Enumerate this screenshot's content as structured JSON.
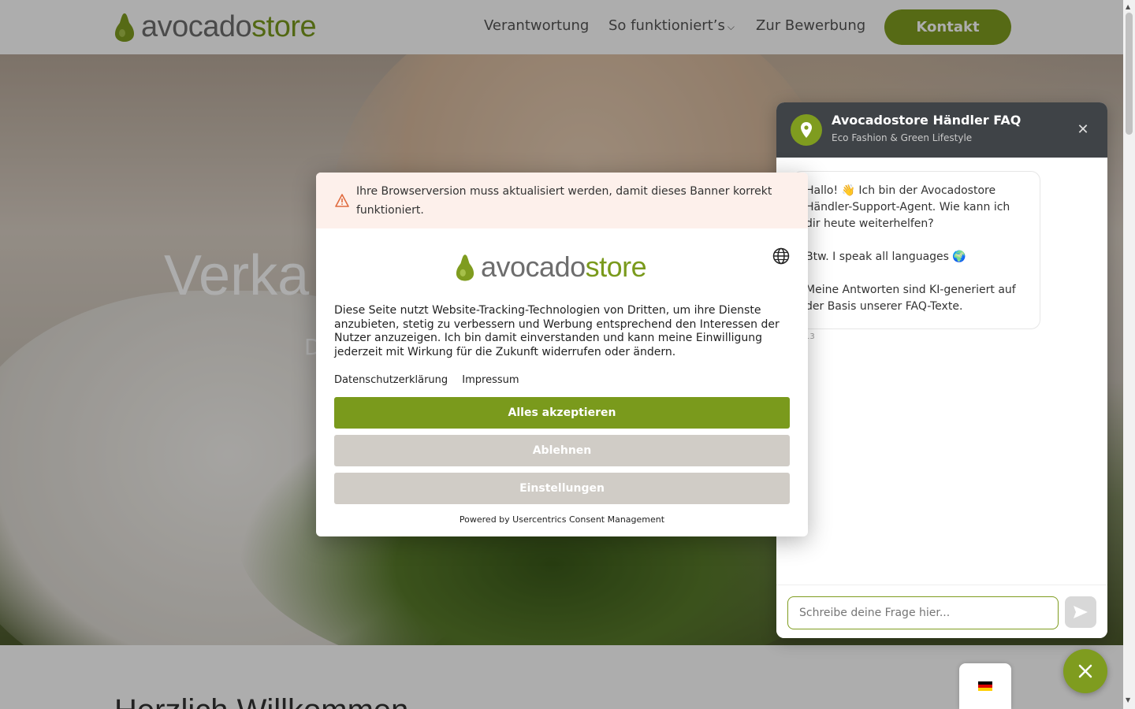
{
  "brand": {
    "part1": "avocado",
    "part2": "store",
    "accent": "#7f9c1f"
  },
  "nav": {
    "items": [
      "Verantwortung",
      "So funktioniert’s",
      "Zur Bewerbung"
    ],
    "contact_label": "Kontakt"
  },
  "hero": {
    "title": "Verka",
    "subtitle": "D"
  },
  "below": {
    "title": "Herzlich Willkommen"
  },
  "chat": {
    "title": "Avocadostore Händler FAQ",
    "subtitle": "Eco Fashion & Green Lifestyle",
    "messages": [
      "Hallo! 👋 Ich bin der Avocadostore Händler-Support-Agent. Wie kann ich dir heute weiterhelfen?",
      "Btw. I speak all languages 🌍",
      "Meine Antworten sind KI-generiert auf der Basis unserer FAQ-Texte."
    ],
    "timestamp": "13",
    "input_placeholder": "Schreibe deine Frage hier..."
  },
  "consent": {
    "warning": "Ihre Browserversion muss aktualisiert werden, damit dieses Banner korrekt funktioniert.",
    "text": "Diese Seite nutzt Website-Tracking-Technologien von Dritten, um ihre Dienste anzubieten, stetig zu verbessern und Werbung entsprechend den Interessen der Nutzer anzuzeigen.  Ich bin damit einverstanden und kann meine Einwilligung jederzeit mit Wirkung für die Zukunft widerrufen oder ändern.",
    "link_privacy": "Datenschutzerklärung",
    "link_imprint": "Impressum",
    "accept_label": "Alles akzeptieren",
    "deny_label": "Ablehnen",
    "settings_label": "Einstellungen",
    "powered_by": "Powered by Usercentrics Consent Management"
  }
}
